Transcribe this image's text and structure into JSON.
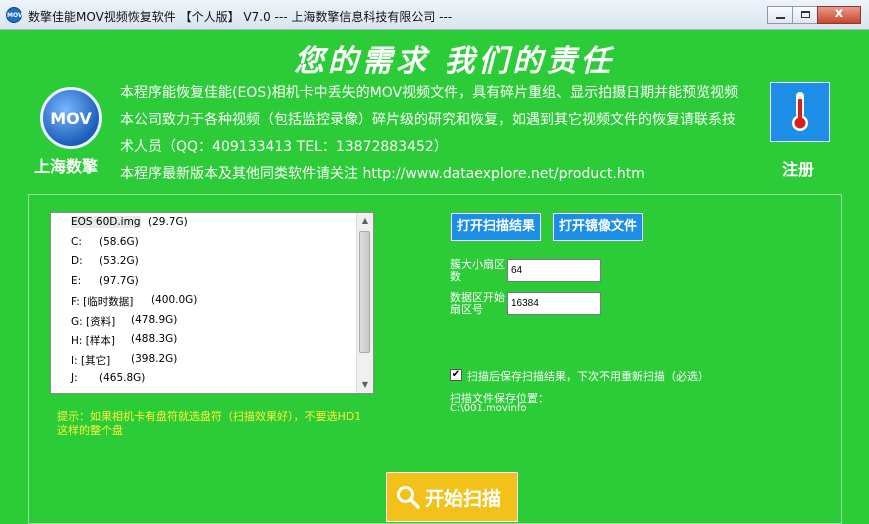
{
  "window": {
    "title": "数擎佳能MOV视频恢复软件  【个人版】  V7.0  ---  上海数擎信息科技有限公司  ---",
    "icon_text": "MOV",
    "close_glyph": "x"
  },
  "header": {
    "slogan": "您的需求   我们的责任",
    "logo_text": "MOV",
    "company": "上海数擎",
    "description_lines": [
      "本程序能恢复佳能(EOS)相机卡中丢失的MOV视频文件，具有碎片重组、显示拍摄日期并能预览视频",
      "本公司致力于各种视频（包括监控录像）碎片级的研究和恢复，如遇到其它视频文件的恢复请联系技",
      "术人员（QQ：409133413  TEL：13872883452）",
      "本程序最新版本及其他同类软件请关注 http://www.dataexplore.net/product.htm"
    ],
    "register_label": "注册",
    "register_icon": "thermometer-icon"
  },
  "drives": [
    {
      "name": "EOS 60D.img",
      "size": "(29.7G)"
    },
    {
      "name": "C:",
      "size": "(58.6G)"
    },
    {
      "name": "D:",
      "size": "(53.2G)"
    },
    {
      "name": "E:",
      "size": "(97.7G)"
    },
    {
      "name": "F:  [临时数据]",
      "size": "(400.0G)"
    },
    {
      "name": "G:  [资料]",
      "size": "(478.9G)"
    },
    {
      "name": "H:  [样本]",
      "size": "(488.3G)"
    },
    {
      "name": "I:  [其它]",
      "size": "(398.2G)"
    },
    {
      "name": "J:",
      "size": "(465.8G)"
    }
  ],
  "hint": "提示：如果相机卡有盘符就选盘符（扫描效果好），不要选HD1这样的整个盘",
  "buttons": {
    "open_scan_result": "打开扫描结果",
    "open_image_file": "打开镜像文件",
    "start_scan": "开始扫描"
  },
  "fields": {
    "cluster_label": "簇大小扇区数",
    "cluster_value": "64",
    "start_sector_label": "数据区开始扇区号",
    "start_sector_value": "16384"
  },
  "options": {
    "save_checked": true,
    "check_mark": "✔",
    "save_label": "扫描后保存扫描结果，下次不用重新扫描（必选）",
    "path_label": "扫描文件保存位置：",
    "path_value": "C:\\001.movinfo"
  }
}
